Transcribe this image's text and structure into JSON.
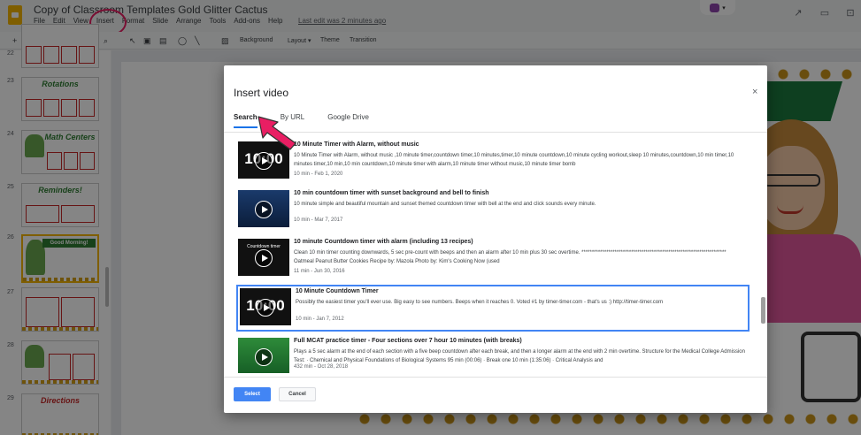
{
  "header": {
    "doc_title": "Copy of Classroom Templates Gold Glitter Cactus",
    "menu": [
      "File",
      "Edit",
      "View",
      "Insert",
      "Format",
      "Slide",
      "Arrange",
      "Tools",
      "Add-ons",
      "Help"
    ],
    "last_edit": "Last edit was 2 minutes ago"
  },
  "toolbar": {
    "background_label": "Background",
    "layout_label": "Layout ▾",
    "theme_label": "Theme",
    "transition_label": "Transition"
  },
  "filmstrip": {
    "slides": [
      {
        "num": "22",
        "title": ""
      },
      {
        "num": "23",
        "title": "Rotations"
      },
      {
        "num": "24",
        "title": "Math Centers"
      },
      {
        "num": "25",
        "title": "Reminders!"
      },
      {
        "num": "26",
        "title": "Good Morning!"
      },
      {
        "num": "27",
        "title": ""
      },
      {
        "num": "28",
        "title": ""
      },
      {
        "num": "29",
        "title": "Directions"
      }
    ]
  },
  "dialog": {
    "title": "Insert video",
    "close": "×",
    "tabs": [
      "Search",
      "By URL",
      "Google Drive"
    ],
    "results": [
      {
        "title": "10 Minute Timer with Alarm, without music",
        "description": "10 Minute Timer with Alarm, without music ,10 minute timer,countdown timer,10 minutes,timer,10 minute countdown,10 minute cycling workout,sleep 10 minutes,countdown,10 min timer,10 minutes timer,10 min,10 min countdown,10 minute timer with alarm,10 minute timer without music,10 minute timer bomb",
        "meta": "10 min - Feb 1, 2020",
        "thumb_text": "10:00"
      },
      {
        "title": "10 min countdown timer with sunset background and bell to finish",
        "description": "10 minute simple and beautiful mountain and sunset themed countdown timer with bell at the end and click sounds every minute.",
        "meta": "10 min - Mar 7, 2017",
        "thumb_text": ""
      },
      {
        "title": "10 minute Countdown timer with alarm (including 13 recipes)",
        "description": "Clean 10 min timer counting downwards, 5 sec pre-count with beeps and then an alarm after 10 min plus 30 sec overtime. ********************************************************************** Oatmeal Peanut Butter Cookies Recipe by: Mazola Photo by: Kim's Cooking Now (used",
        "meta": "11 min - Jun 30, 2016",
        "thumb_text": "Countdown timer"
      },
      {
        "title": "10 Minute Countdown Timer",
        "description": "Possibly the easiest timer you'll ever use. Big easy to see numbers. Beeps when it reaches 0. Voted #1 by timer-timer.com - that's us :) http://timer-timer.com",
        "meta": "10 min - Jan 7, 2012",
        "thumb_text": "10:00"
      },
      {
        "title": "Full MCAT practice timer - Four sections over 7 hour 10 minutes (with breaks)",
        "description": "Plays a 5 sec alarm at the end of each section with a five beep countdown after each break, and then a longer alarm at the end with 2 min overtime. Structure for the Medical College Admission Test: · Chemical and Physical Foundations of Biological Systems 95 min (00:06) · Break one 10 min (1:35:06) · Critical Analysis and",
        "meta": "432 min - Oct 28, 2018",
        "thumb_text": ""
      }
    ],
    "select_label": "Select",
    "cancel_label": "Cancel"
  },
  "colors": {
    "accent": "#4285f4",
    "annotation": "#e91e63",
    "brand": "#f4b400"
  }
}
